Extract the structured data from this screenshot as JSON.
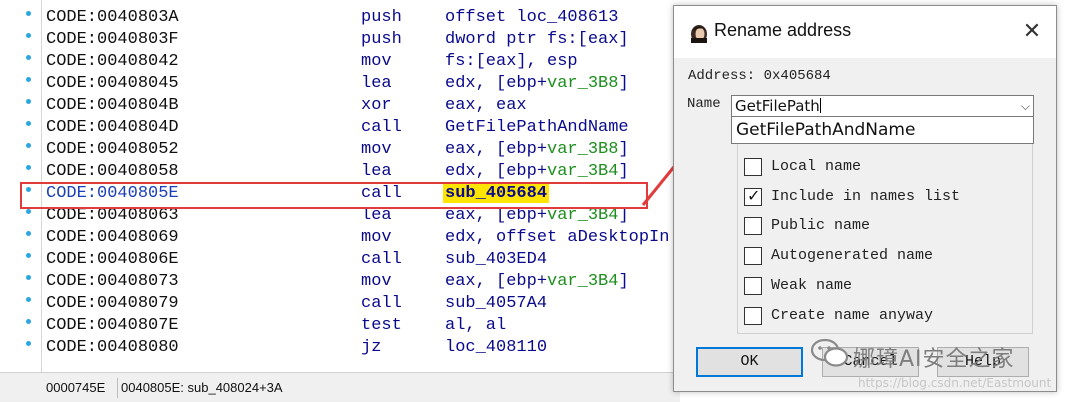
{
  "listing": {
    "rows": [
      {
        "addr": "CODE:0040803A",
        "mn": "push",
        "ops": "offset loc_408613"
      },
      {
        "addr": "CODE:0040803F",
        "mn": "push",
        "ops": "dword ptr fs:[eax]"
      },
      {
        "addr": "CODE:00408042",
        "mn": "mov",
        "ops": "fs:[eax], esp"
      },
      {
        "addr": "CODE:00408045",
        "mn": "lea",
        "ops_pre": "edx, [ebp+",
        "ops_var": "var_3B8",
        "ops_post": "]"
      },
      {
        "addr": "CODE:0040804B",
        "mn": "xor",
        "ops": "eax, eax"
      },
      {
        "addr": "CODE:0040804D",
        "mn": "call",
        "ops": "GetFilePathAndName"
      },
      {
        "addr": "CODE:00408052",
        "mn": "mov",
        "ops_pre": "eax, [ebp+",
        "ops_var": "var_3B8",
        "ops_post": "]"
      },
      {
        "addr": "CODE:00408058",
        "mn": "lea",
        "ops_pre": "edx, [ebp+",
        "ops_var": "var_3B4",
        "ops_post": "]"
      },
      {
        "addr": "CODE:0040805E",
        "mn": "call",
        "ops": "sub_405684"
      },
      {
        "addr": "CODE:00408063",
        "mn": "lea",
        "ops_pre": "eax, [ebp+",
        "ops_var": "var_3B4",
        "ops_post": "]"
      },
      {
        "addr": "CODE:00408069",
        "mn": "mov",
        "ops": "edx, offset aDesktopIn"
      },
      {
        "addr": "CODE:0040806E",
        "mn": "call",
        "ops": "sub_403ED4"
      },
      {
        "addr": "CODE:00408073",
        "mn": "mov",
        "ops_pre": "eax, [ebp+",
        "ops_var": "var_3B4",
        "ops_post": "]"
      },
      {
        "addr": "CODE:00408079",
        "mn": "call",
        "ops": "sub_4057A4"
      },
      {
        "addr": "CODE:0040807E",
        "mn": "test",
        "ops": "al, al"
      },
      {
        "addr": "CODE:00408080",
        "mn": "jz",
        "ops": "loc_408110"
      }
    ],
    "highlight_color": "#ffe500",
    "box_color": "#e23b3b"
  },
  "status": {
    "offset": "0000745E",
    "location": "0040805E: sub_408024+3A"
  },
  "dialog": {
    "title": "Rename address",
    "close_icon": "close-icon",
    "address_label": "Address: 0x405684",
    "name_label": "Name",
    "name_value": "GetFilePath",
    "suggestion": "GetFilePathAndName",
    "checkboxes": [
      {
        "label": "Local name",
        "checked": false
      },
      {
        "label": "Include in names list",
        "checked": true
      },
      {
        "label": "Public name",
        "checked": false
      },
      {
        "label": "Autogenerated name",
        "checked": false
      },
      {
        "label": "Weak name",
        "checked": false
      },
      {
        "label": "Create name anyway",
        "checked": false
      }
    ],
    "ok_label": "OK",
    "cancel_label": "Cancel",
    "help_label": "Help"
  },
  "watermark": {
    "text": "娜璋AI安全之家",
    "url": "https://blog.csdn.net/Eastmount"
  }
}
